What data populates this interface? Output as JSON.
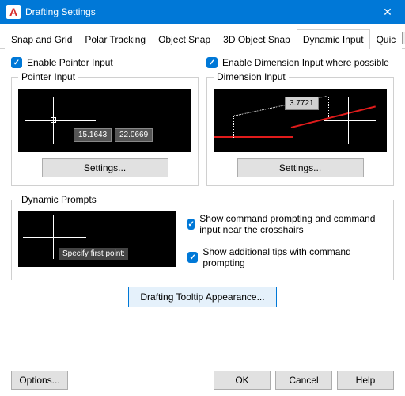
{
  "window": {
    "title": "Drafting Settings",
    "logo": "A"
  },
  "tabs": {
    "items": [
      "Snap and Grid",
      "Polar Tracking",
      "Object Snap",
      "3D Object Snap",
      "Dynamic Input",
      "Quic"
    ],
    "activeIndex": 4
  },
  "dynamicInput": {
    "enablePointer": "Enable Pointer Input",
    "enableDimension": "Enable Dimension Input where possible",
    "pointer": {
      "legend": "Pointer Input",
      "coord1": "15.1643",
      "coord2": "22.0669",
      "settings": "Settings..."
    },
    "dimension": {
      "legend": "Dimension Input",
      "value": "3.7721",
      "settings": "Settings..."
    },
    "prompts": {
      "legend": "Dynamic Prompts",
      "previewText": "Specify first point:",
      "opt1": "Show command prompting and command input near the crosshairs",
      "opt2": "Show additional tips with command prompting"
    },
    "tooltipBtn": "Drafting Tooltip Appearance..."
  },
  "footer": {
    "options": "Options...",
    "ok": "OK",
    "cancel": "Cancel",
    "help": "Help"
  }
}
